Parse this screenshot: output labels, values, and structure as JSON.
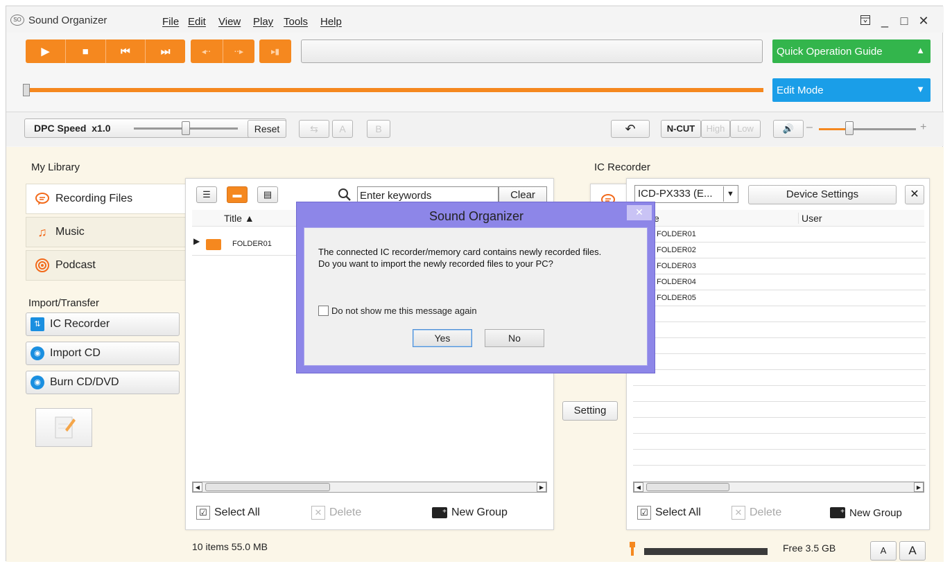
{
  "app": {
    "logo": "SO",
    "title": "Sound Organizer"
  },
  "menu": [
    "File",
    "Edit",
    "View",
    "Play",
    "Tools",
    "Help"
  ],
  "window_controls": {
    "pin": "pin-icon",
    "minimize": "_",
    "maximize": "□",
    "close": "✕"
  },
  "transport": {
    "play": "▶",
    "stop": "■",
    "prev": "⏮",
    "next": "⏭",
    "step_back": "◂··",
    "step_fwd": "··▸",
    "mark": "▸▮"
  },
  "right_buttons": {
    "quick_guide": "Quick Operation Guide",
    "quick_guide_arrow": "▲",
    "edit_mode": "Edit Mode",
    "edit_mode_arrow": "▼"
  },
  "dpc": {
    "label": "DPC Speed",
    "value": "x1.0",
    "reset": "Reset",
    "speed_position": 0.5
  },
  "ab": {
    "repeat": "⇆",
    "a": "A",
    "b": "B"
  },
  "audio": {
    "undo_icon": "↶",
    "ncut": "N-CUT",
    "high": "High",
    "low": "Low",
    "speaker": "🔊",
    "minus": "–",
    "plus": "+"
  },
  "library": {
    "label": "My Library",
    "tabs": [
      {
        "label": "Recording Files",
        "icon": "chat-icon"
      },
      {
        "label": "Music",
        "icon": "music-note-icon"
      },
      {
        "label": "Podcast",
        "icon": "podcast-icon"
      }
    ]
  },
  "import_transfer": {
    "label": "Import/Transfer",
    "buttons": [
      {
        "label": "IC Recorder",
        "icon": "ic-recorder-icon"
      },
      {
        "label": "Import CD",
        "icon": "cd-import-icon"
      },
      {
        "label": "Burn CD/DVD",
        "icon": "cd-burn-icon"
      }
    ]
  },
  "left_panel": {
    "search_placeholder": "Enter keywords",
    "clear": "Clear",
    "column_title": "Title ▲",
    "rows": [
      "FOLDER01"
    ],
    "select_all": "Select All",
    "delete": "Delete",
    "new_group": "New Group",
    "status": "10 items 55.0 MB"
  },
  "ic_recorder": {
    "label": "IC Recorder",
    "device": "ICD-PX333 (E...",
    "device_settings": "Device Settings",
    "close": "✕",
    "col_name": "e",
    "col_user": "User",
    "rows": [
      "FOLDER01",
      "FOLDER02",
      "FOLDER03",
      "FOLDER04",
      "FOLDER05"
    ],
    "select_all": "Select All",
    "delete": "Delete",
    "new_group": "New Group",
    "free": "Free 3.5 GB",
    "font_small": "A",
    "font_large": "A"
  },
  "setting_button": "Setting",
  "dialog": {
    "title": "Sound Organizer",
    "close": "✕",
    "message_line1": "The connected IC recorder/memory card contains newly recorded files.",
    "message_line2": "Do you want to import the newly recorded files to your PC?",
    "checkbox": "Do not show me this message again",
    "yes": "Yes",
    "no": "No"
  },
  "colors": {
    "orange": "#f5881f",
    "green": "#33b54c",
    "blue": "#1a9ee8",
    "dialog_frame": "#8d86e8",
    "body_bg": "#fbf6e8"
  }
}
